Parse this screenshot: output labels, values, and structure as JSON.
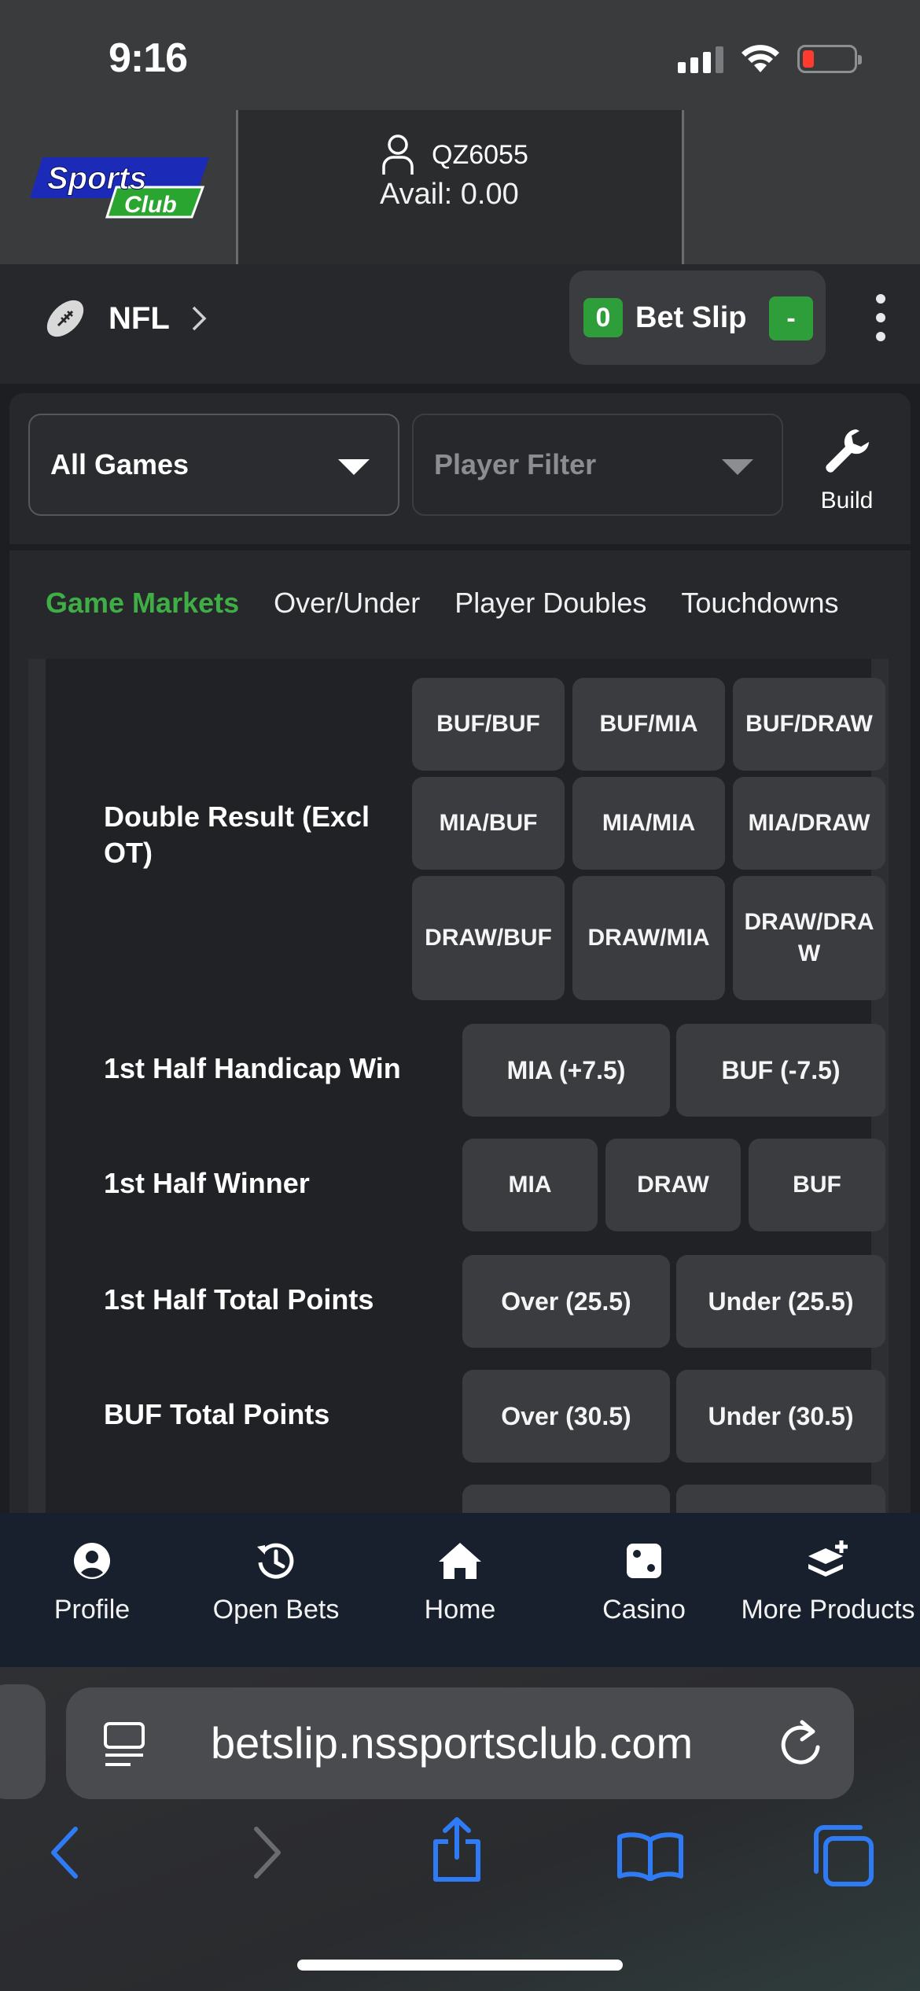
{
  "status_bar": {
    "time": "9:16",
    "icons": [
      "signal-icon",
      "wifi-icon",
      "battery-low-icon"
    ]
  },
  "header": {
    "logo_text": "Sports Club",
    "username": "QZ6055",
    "available": "Avail: 0.00"
  },
  "league_bar": {
    "league": "NFL",
    "betslip_count": "0",
    "betslip_label": "Bet Slip",
    "betslip_toggle": "-"
  },
  "filters": {
    "games_value": "All Games",
    "player_placeholder": "Player Filter",
    "build_label": "Build"
  },
  "tabs": [
    {
      "label": "Game Markets",
      "active": true
    },
    {
      "label": "Over/Under",
      "active": false
    },
    {
      "label": "Player Doubles",
      "active": false
    },
    {
      "label": "Touchdowns",
      "active": false
    }
  ],
  "markets": {
    "double_result": {
      "label": "Double Result (Excl OT)",
      "options": [
        "BUF/BUF",
        "BUF/MIA",
        "BUF/DRAW",
        "MIA/BUF",
        "MIA/MIA",
        "MIA/DRAW",
        "DRAW/BUF",
        "DRAW/MIA",
        "DRAW/DRAW"
      ]
    },
    "first_half_handicap": {
      "label": "1st Half Handicap Win",
      "options": [
        "MIA (+7.5)",
        "BUF (-7.5)"
      ]
    },
    "first_half_winner": {
      "label": "1st Half Winner",
      "options": [
        "MIA",
        "DRAW",
        "BUF"
      ]
    },
    "first_half_total": {
      "label": "1st Half Total Points",
      "options": [
        "Over (25.5)",
        "Under (25.5)"
      ]
    },
    "buf_total": {
      "label": "BUF Total Points",
      "options": [
        "Over (30.5)",
        "Under (30.5)"
      ]
    }
  },
  "bottom_nav": [
    {
      "label": "Profile",
      "icon": "profile-icon"
    },
    {
      "label": "Open Bets",
      "icon": "history-icon"
    },
    {
      "label": "Home",
      "icon": "home-icon"
    },
    {
      "label": "Casino",
      "icon": "dice-icon"
    },
    {
      "label": "More Products",
      "icon": "more-products-icon"
    }
  ],
  "browser": {
    "url": "betslip.nssportsclub.com",
    "toolbar": [
      "back-icon",
      "forward-icon",
      "share-icon",
      "bookmarks-icon",
      "tabs-icon"
    ]
  },
  "colors": {
    "accent_green": "#3fae45",
    "background": "#1d1e21",
    "nav_bg": "#17202c",
    "ios_blue": "#2f7bf5"
  }
}
